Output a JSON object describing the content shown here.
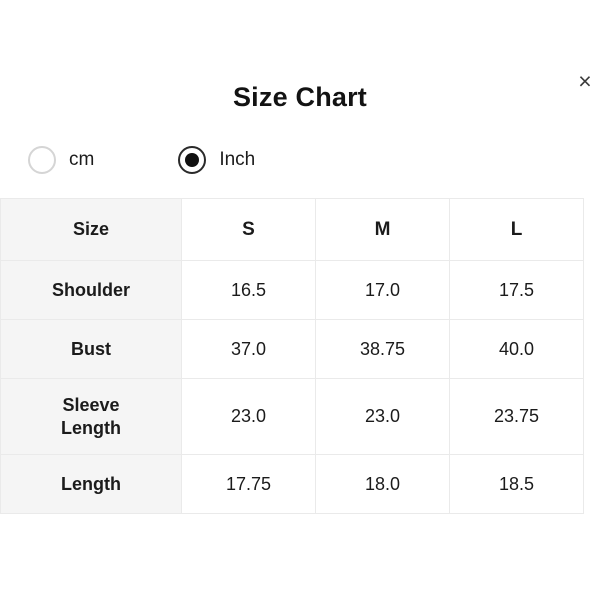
{
  "dialog": {
    "title": "Size Chart",
    "close_icon": "close-icon",
    "close_label": "×"
  },
  "unit_selector": {
    "options": [
      {
        "label": "cm",
        "value": "cm",
        "selected": false
      },
      {
        "label": "Inch",
        "value": "inch",
        "selected": true
      }
    ]
  },
  "table": {
    "columns": [
      "Size",
      "S",
      "M",
      "L"
    ],
    "rows": [
      {
        "label": "Shoulder",
        "values": [
          "16.5",
          "17.0",
          "17.5"
        ]
      },
      {
        "label": "Bust",
        "values": [
          "37.0",
          "38.75",
          "40.0"
        ]
      },
      {
        "label": "Sleeve Length",
        "label_line1": "Sleeve",
        "label_line2": "Length",
        "values": [
          "23.0",
          "23.0",
          "23.75"
        ]
      },
      {
        "label": "Length",
        "values": [
          "17.75",
          "18.0",
          "18.5"
        ]
      }
    ]
  },
  "colors": {
    "background": "#ffffff",
    "text": "#1b1b1b",
    "label_cell_bg": "#f5f5f5",
    "border": "#eaeaea",
    "radio_off": "#d5d5d5",
    "radio_on": "#2a2a2a"
  }
}
